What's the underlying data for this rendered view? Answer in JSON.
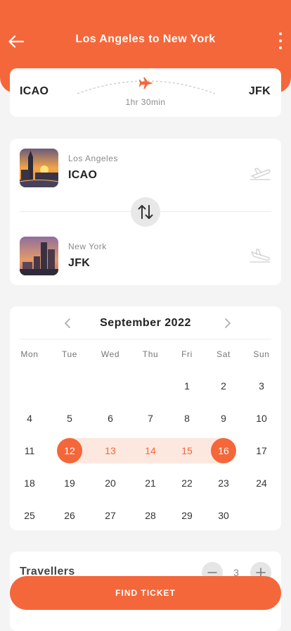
{
  "header": {
    "title": "Los Angeles to New York",
    "color": "#f4673a",
    "back_icon": "arrow-left-icon",
    "more_icon": "more-vertical-icon"
  },
  "route": {
    "from_code": "ICAO",
    "to_code": "JFK",
    "duration": "1hr 30min",
    "icon": "airplane-icon"
  },
  "cities": {
    "origin": {
      "name": "Los Angeles",
      "code": "ICAO",
      "icon": "takeoff-icon"
    },
    "destination": {
      "name": "New York",
      "code": "JFK",
      "icon": "landing-icon"
    },
    "swap_icon": "swap-vertical-icon"
  },
  "calendar": {
    "month": "September 2022",
    "weekdays": [
      "Mon",
      "Tue",
      "Wed",
      "Thu",
      "Fri",
      "Sat",
      "Sun"
    ],
    "days": [
      "1",
      "2",
      "3",
      "4",
      "5",
      "6",
      "7",
      "8",
      "9",
      "10",
      "11",
      "12",
      "13",
      "14",
      "15",
      "16",
      "17",
      "18",
      "19",
      "20",
      "21",
      "22",
      "23",
      "24",
      "25",
      "26",
      "27",
      "28",
      "29",
      "30"
    ],
    "range_start": "12",
    "range_end": "16",
    "accent": "#f4673a",
    "range_fill": "#fde8e0"
  },
  "travellers": {
    "label": "Travellers",
    "count": "3",
    "minus_icon": "minus-icon",
    "plus_icon": "plus-icon"
  },
  "cta": {
    "label": "FIND TICKET"
  }
}
